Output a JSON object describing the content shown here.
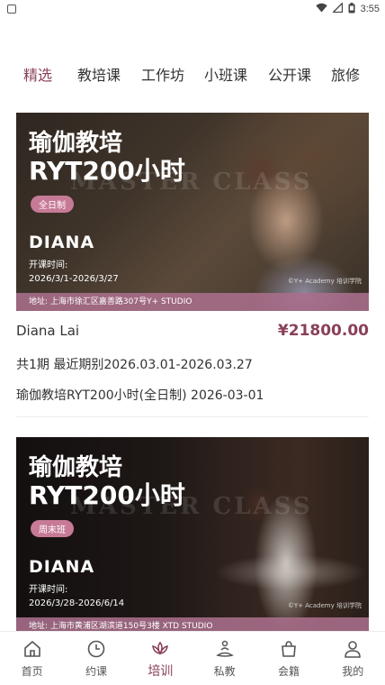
{
  "status_bar": {
    "time": "3:55",
    "icons": [
      "notification-square-icon",
      "wifi-icon",
      "signal-icon",
      "battery-icon"
    ]
  },
  "tabs": [
    {
      "label": "精选",
      "active": true
    },
    {
      "label": "教培课",
      "active": false
    },
    {
      "label": "工作坊",
      "active": false
    },
    {
      "label": "小班课",
      "active": false
    },
    {
      "label": "公开课",
      "active": false
    },
    {
      "label": "旅修",
      "active": false
    }
  ],
  "courses": [
    {
      "banner": {
        "title_line1": "瑜伽教培",
        "title_line2": "RYT200小时",
        "ghost_text": "MASTER CLASS",
        "tag": "全日制",
        "brand": "DIANA",
        "open_label": "开课时间:",
        "open_dates": "2026/3/1-2026/3/27",
        "credit": "©Y+ Academy 培训学院",
        "address": "地址: 上海市徐汇区嘉善路307号Y+ STUDIO"
      },
      "teacher": "Diana Lai",
      "price": "¥21800.00",
      "period_line": "共1期  最近期别2026.03.01-2026.03.27",
      "name_line": "瑜伽教培RYT200小时(全日制)  2026-03-01"
    },
    {
      "banner": {
        "title_line1": "瑜伽教培",
        "title_line2": "RYT200小时",
        "ghost_text": "MASTER CLASS",
        "tag": "周末班",
        "brand": "DIANA",
        "open_label": "开课时间:",
        "open_dates": "2026/3/28-2026/6/14",
        "credit": "©Y+ Academy 培训学院",
        "address": "地址: 上海市黄浦区湖滨道150号3楼 XTD STUDIO"
      }
    }
  ],
  "bottom_nav": [
    {
      "label": "首页",
      "icon": "home-icon",
      "active": false
    },
    {
      "label": "约课",
      "icon": "clock-icon",
      "active": false
    },
    {
      "label": "培训",
      "icon": "lotus-icon",
      "active": true
    },
    {
      "label": "私教",
      "icon": "meditation-person-icon",
      "active": false
    },
    {
      "label": "会籍",
      "icon": "shopping-bag-icon",
      "active": false
    },
    {
      "label": "我的",
      "icon": "user-icon",
      "active": false
    }
  ],
  "colors": {
    "accent": "#8a3f5a",
    "pill": "#c77a96",
    "address_bar": "#aa6e8c"
  }
}
